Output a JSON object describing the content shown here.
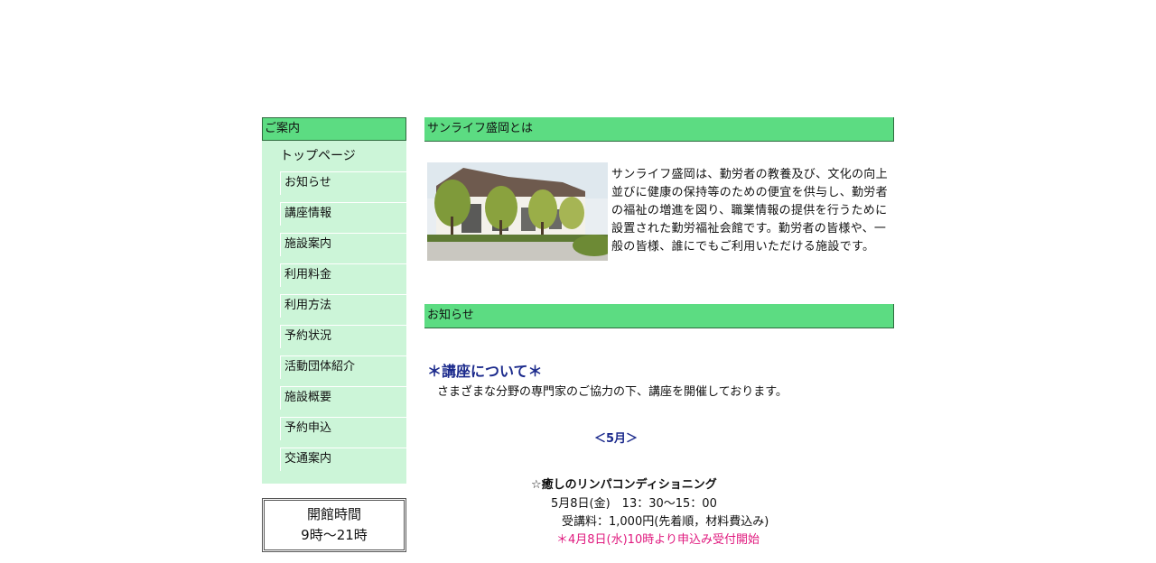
{
  "sidebar": {
    "heading": "ご案内",
    "top_page": "トップページ",
    "items": [
      {
        "label": "お知らせ"
      },
      {
        "label": "講座情報"
      },
      {
        "label": "施設案内"
      },
      {
        "label": "利用料金"
      },
      {
        "label": "利用方法"
      },
      {
        "label": "予約状況"
      },
      {
        "label": "活動団体紹介"
      },
      {
        "label": "施設概要"
      },
      {
        "label": "予約申込"
      },
      {
        "label": "交通案内"
      }
    ],
    "hours_title": "開館時間",
    "hours_value": "9時～21時"
  },
  "about": {
    "heading": "サンライフ盛岡とは",
    "text": "サンライフ盛岡は、勤労者の教養及び、文化の向上並びに健康の保持等のための便宜を供与し、勤労者の福祉の増進を図り、職業情報の提供を行うために設置された勤労福祉会館です。勤労者の皆様や、一般の皆様、誰にでもご利用いただける施設です。"
  },
  "notice": {
    "heading": "お知らせ",
    "course_title": "＊講座について＊",
    "course_desc": "さまざまな分野の専門家のご協力の下、講座を開催しております。",
    "month": "＜5月＞",
    "event_name": "☆癒しのリンパコンディショニング",
    "event_date": "5月8日(金)　13：30～15：00",
    "event_fee": "受講料：1,000円(先着順，材料費込み)",
    "event_apply": "＊4月8日(水)10時より申込み受付開始"
  },
  "colors": {
    "header_green": "#5cdc82",
    "sidebar_bg": "#ccf5d8",
    "title_blue": "#1b2a8c",
    "notice_pink": "#e0197e"
  }
}
